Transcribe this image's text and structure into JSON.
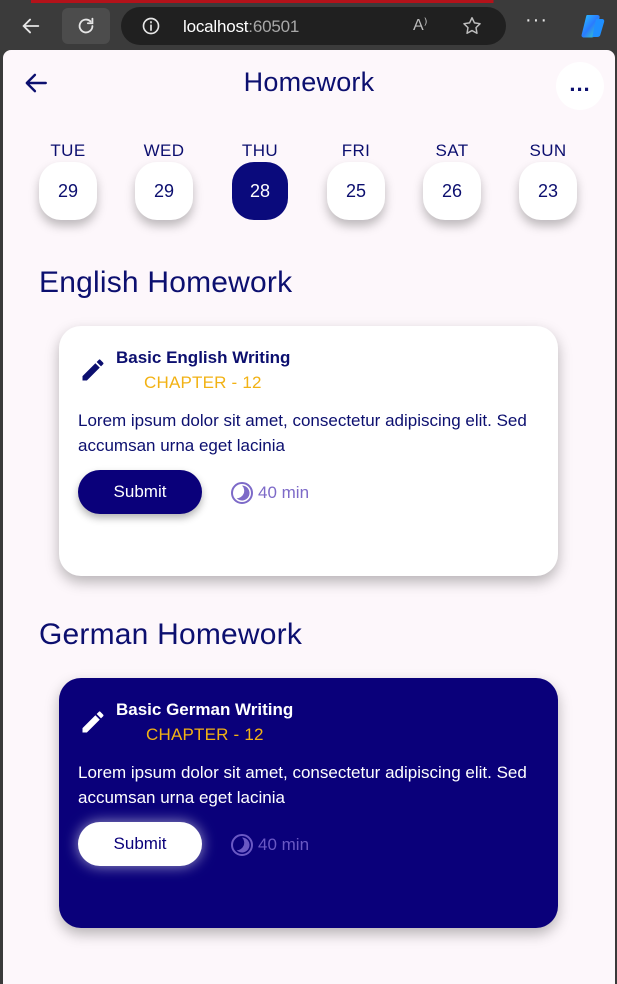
{
  "browser": {
    "url_host": "localhost",
    "url_port": ":60501",
    "read_aloud": "A⁾"
  },
  "appbar": {
    "title": "Homework",
    "more": "..."
  },
  "days": [
    {
      "name": "TUE",
      "num": "29",
      "active": false
    },
    {
      "name": "WED",
      "num": "29",
      "active": false
    },
    {
      "name": "THU",
      "num": "28",
      "active": true
    },
    {
      "name": "FRI",
      "num": "25",
      "active": false
    },
    {
      "name": "SAT",
      "num": "26",
      "active": false
    },
    {
      "name": "SUN",
      "num": "23",
      "active": false
    }
  ],
  "sections": [
    {
      "title": "English Homework",
      "card": {
        "title": "Basic English Writing",
        "chapter": "CHAPTER - 12",
        "description": "Lorem ipsum dolor sit amet, consectetur adipiscing elit. Sed accumsan urna eget lacinia",
        "submit_label": "Submit",
        "duration": "40 min"
      }
    },
    {
      "title": "German Homework",
      "card": {
        "title": "Basic German Writing",
        "chapter": "CHAPTER - 12",
        "description": "Lorem ipsum dolor sit amet, consectetur adipiscing elit. Sed accumsan urna eget lacinia",
        "submit_label": "Submit",
        "duration": "40 min"
      }
    }
  ],
  "colors": {
    "primary": "#0a007a",
    "accent": "#f2b214",
    "background": "#fdf7fb"
  }
}
